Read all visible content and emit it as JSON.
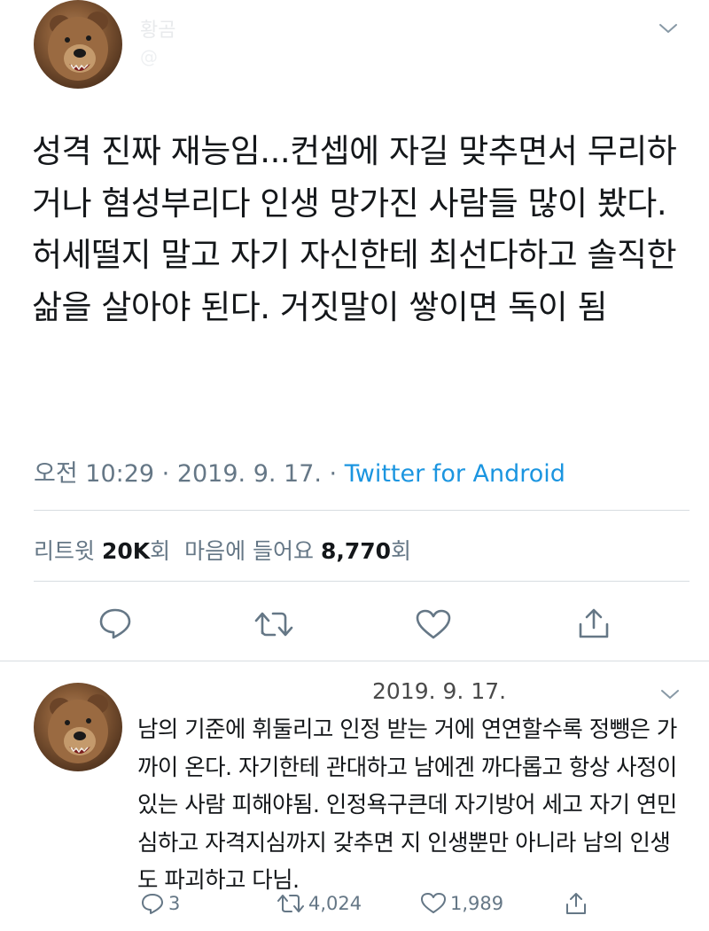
{
  "tweet": {
    "author_name": "황곰",
    "author_handle": "@",
    "text": "성격 진짜 재능임...컨셉에 자길 맞추면서 무리하거나 혐성부리다 인생 망가진 사람들 많이 봤다. 허세떨지 말고 자기 자신한테 최선다하고 솔직한 삶을 살아야 된다. 거짓말이 쌓이면 독이 됨",
    "time": "오전 10:29 · 2019. 9. 17. · ",
    "source": "Twitter for Android",
    "retweet_label": "리트윗",
    "retweet_count": "20K",
    "retweet_unit": "회",
    "like_label": "마음에 들어요",
    "like_count": "8,770",
    "like_unit": "회"
  },
  "icons": {
    "reply": "reply-icon",
    "retweet": "retweet-icon",
    "like": "heart-icon",
    "share": "share-icon",
    "menu": "chevron-down-icon"
  },
  "reply": {
    "date": "2019. 9. 17.",
    "text": "남의 기준에 휘둘리고 인정 받는 거에 연연할수록 정뺑은 가까이 온다. 자기한테 관대하고 남에겐 까다롭고 항상 사정이 있는 사람 피해야됨. 인정욕구큰데 자기방어 세고 자기 연민 심하고 자격지심까지 갖추면 지 인생뿐만 아니라 남의 인생도 파괴하고 다님.",
    "reply_count": "3",
    "retweet_count": "4,024",
    "like_count": "1,989"
  },
  "colors": {
    "accent": "#1b95e0",
    "secondary_text": "#657786",
    "divider": "#d8dde1"
  }
}
